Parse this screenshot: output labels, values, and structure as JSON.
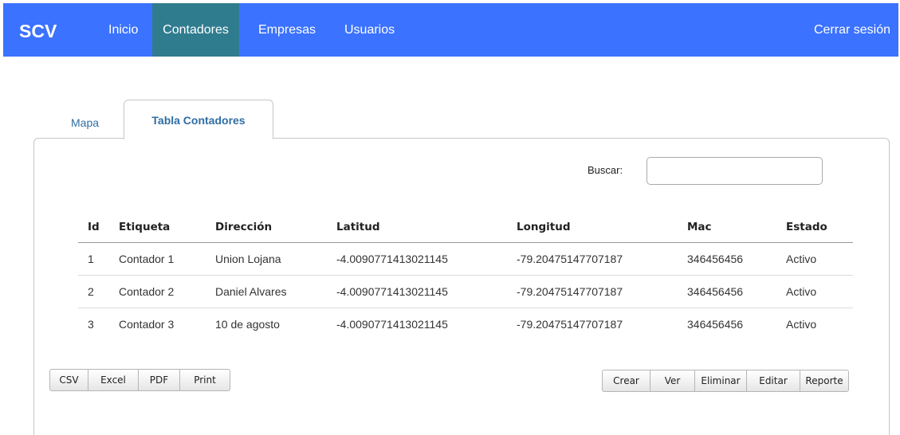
{
  "navbar": {
    "brand": "SCV",
    "items": [
      "Inicio",
      "Contadores",
      "Empresas",
      "Usuarios"
    ],
    "logout": "Cerrar sesión"
  },
  "tabs": {
    "map": "Mapa",
    "table": "Tabla Contadores"
  },
  "search": {
    "label": "Buscar:",
    "value": ""
  },
  "table": {
    "headers": [
      "Id",
      "Etiqueta",
      "Dirección",
      "Latitud",
      "Longitud",
      "Mac",
      "Estado"
    ],
    "rows": [
      [
        "1",
        "Contador 1",
        "Union Lojana",
        "-4.0090771413021145",
        "-79.20475147707187",
        "346456456",
        "Activo"
      ],
      [
        "2",
        "Contador 2",
        "Daniel Alvares",
        "-4.0090771413021145",
        "-79.20475147707187",
        "346456456",
        "Activo"
      ],
      [
        "3",
        "Contador 3",
        "10 de agosto",
        "-4.0090771413021145",
        "-79.20475147707187",
        "346456456",
        "Activo"
      ]
    ]
  },
  "export_buttons": [
    "CSV",
    "Excel",
    "PDF",
    "Print"
  ],
  "action_buttons": [
    "Crear",
    "Ver",
    "Eliminar",
    "Editar",
    "Reporte"
  ]
}
